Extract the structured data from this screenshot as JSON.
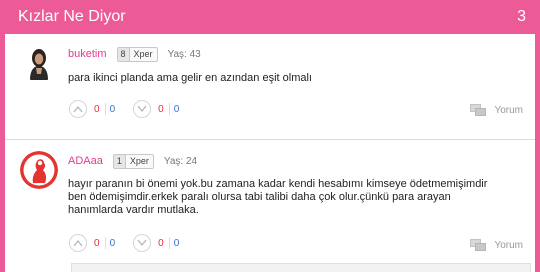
{
  "header": {
    "title": "Kızlar Ne Diyor",
    "count": "3"
  },
  "comments": [
    {
      "username": "buketim",
      "username_color": "#e53a8f",
      "xper_level": "8",
      "xper_label": "Xper",
      "age": "Yaş: 43",
      "text": "para ikinci planda ama gelir en azından eşit olmalı",
      "up_red": "0",
      "up_blue": "0",
      "down_red": "0",
      "down_blue": "0",
      "reply_label": "Yorum"
    },
    {
      "username": "ADAaa",
      "username_color": "#e53a8f",
      "xper_level": "1",
      "xper_label": "Xper",
      "age": "Yaş: 24",
      "text": "hayır paranın bi önemi yok.bu zamana kadar kendi hesabımı kimseye ödetmemişimdir ben ödemişimdir.erkek paralı olursa tabi talibi daha çok olur.çünkü para arayan hanımlarda vardır mutlaka.",
      "up_red": "0",
      "up_blue": "0",
      "down_red": "0",
      "down_blue": "0",
      "reply_label": "Yorum"
    }
  ],
  "icons": [
    "thumb-up-icon",
    "thumb-down-icon",
    "comment-icon"
  ]
}
